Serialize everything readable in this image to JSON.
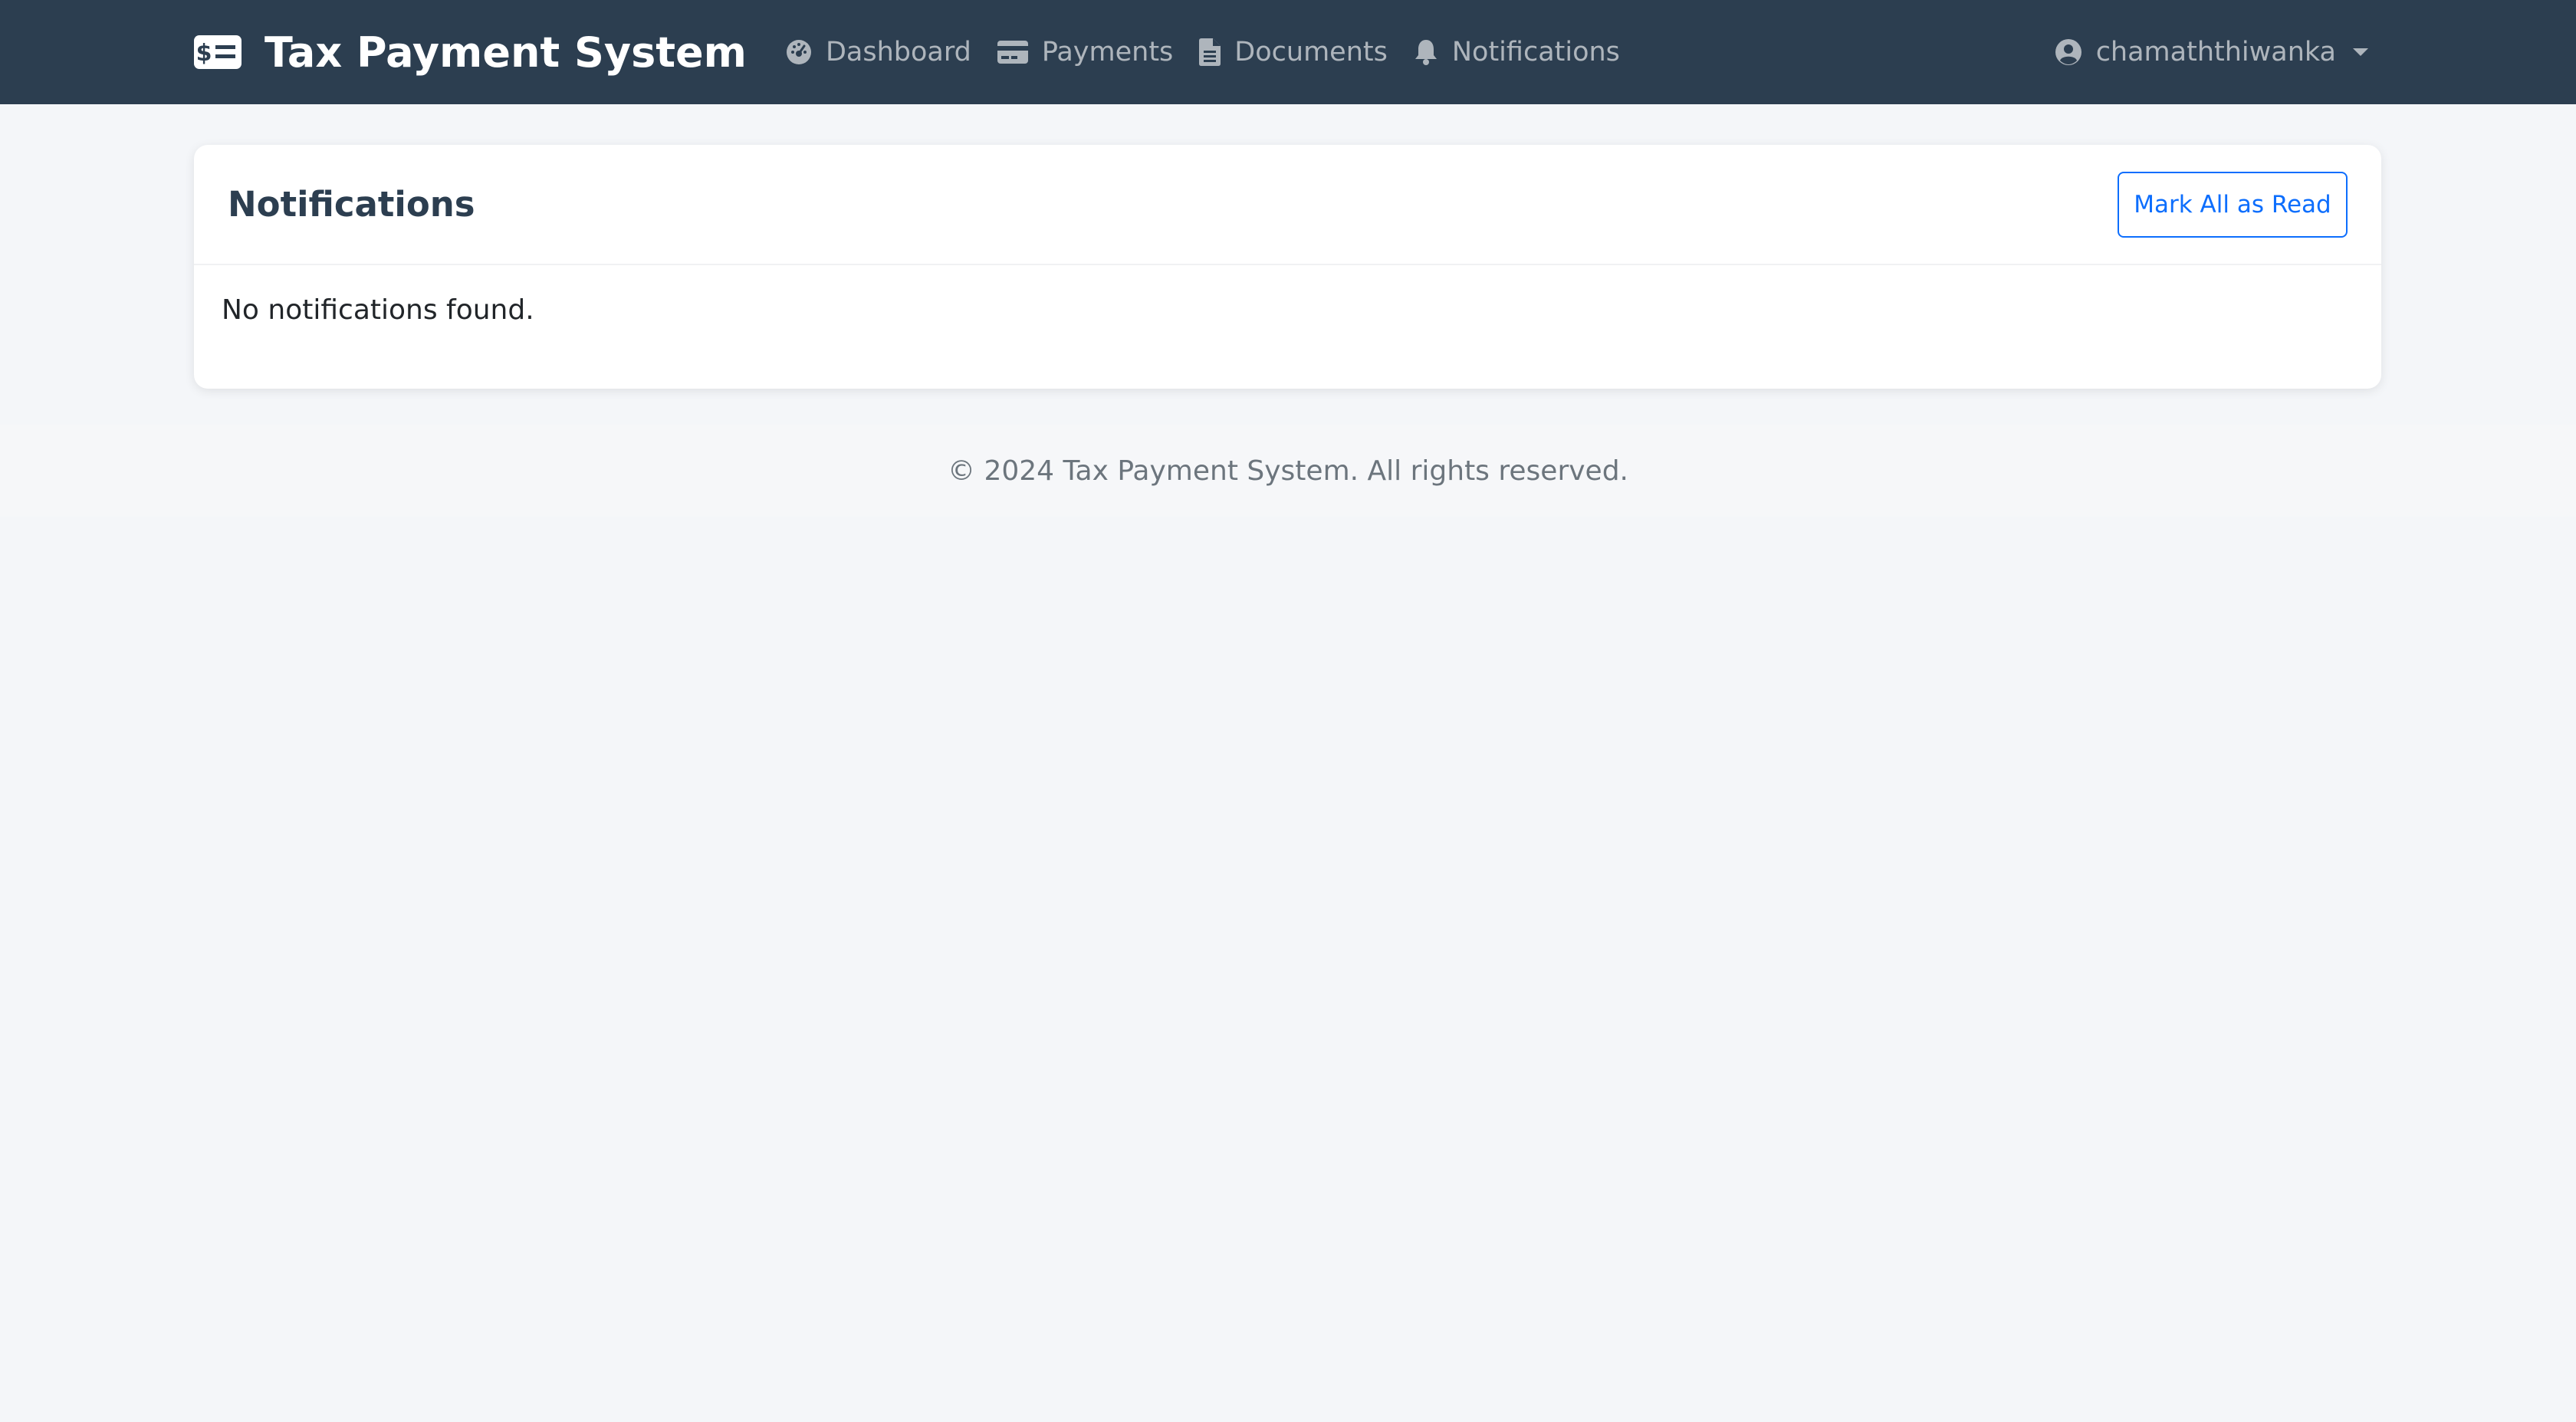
{
  "colors": {
    "navbar_bg": "#2c3e50",
    "page_bg": "#f4f6f9",
    "accent": "#0d6efd",
    "title": "#2c3e50"
  },
  "navbar": {
    "brand": {
      "icon": "money-check-dollar-icon",
      "label": "Tax Payment System"
    },
    "links": [
      {
        "icon": "gauge-icon",
        "label": "Dashboard"
      },
      {
        "icon": "credit-card-icon",
        "label": "Payments"
      },
      {
        "icon": "document-icon",
        "label": "Documents"
      },
      {
        "icon": "bell-icon",
        "label": "Notifications"
      }
    ],
    "user": {
      "icon": "user-circle-icon",
      "name": "chamaththiwanka"
    }
  },
  "card": {
    "title": "Notifications",
    "action_label": "Mark All as Read",
    "empty_message": "No notifications found."
  },
  "footer": {
    "text": "© 2024 Tax Payment System. All rights reserved."
  }
}
